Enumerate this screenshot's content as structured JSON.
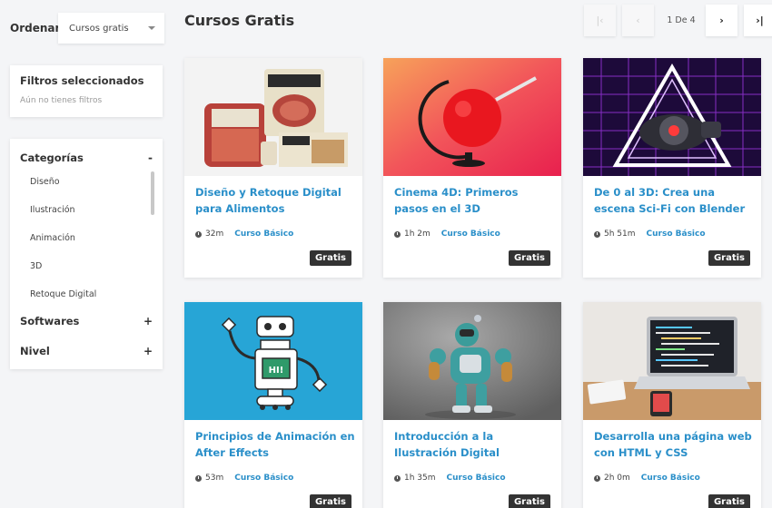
{
  "sort": {
    "label": "Ordenar",
    "selected": "Cursos gratis"
  },
  "filters": {
    "title": "Filtros seleccionados",
    "empty": "Aún no tienes filtros"
  },
  "categories": {
    "title": "Categorías",
    "toggle": "-",
    "items": [
      "Diseño",
      "Ilustración",
      "Animación",
      "3D",
      "Retoque Digital"
    ]
  },
  "softwares": {
    "title": "Softwares",
    "toggle": "+"
  },
  "nivel": {
    "title": "Nivel",
    "toggle": "+"
  },
  "page_title": "Cursos Gratis",
  "pagination": {
    "first": "|‹",
    "prev": "‹",
    "info": "1 De 4",
    "next": "›",
    "last": "›|"
  },
  "courses": [
    {
      "title": "Diseño y Retoque Digital para Alimentos",
      "duration": "32m",
      "level": "Curso Básico",
      "badge": "Gratis",
      "bg": "#f2f2f2"
    },
    {
      "title": "Cinema 4D: Primeros pasos en el 3D",
      "duration": "1h 2m",
      "level": "Curso Básico",
      "badge": "Gratis",
      "bg": "#ef4f4f"
    },
    {
      "title": "De 0 al 3D: Crea una escena Sci-Fi con Blender",
      "duration": "5h 51m",
      "level": "Curso Básico",
      "badge": "Gratis",
      "bg": "#2a0f4a"
    },
    {
      "title": "Principios de Animación en After Effects",
      "duration": "53m",
      "level": "Curso Básico",
      "badge": "Gratis",
      "bg": "#26a4d4"
    },
    {
      "title": "Introducción a la Ilustración Digital",
      "duration": "1h 35m",
      "level": "Curso Básico",
      "badge": "Gratis",
      "bg": "#8a8a8a"
    },
    {
      "title": "Desarrolla una página web con HTML y CSS",
      "duration": "2h 0m",
      "level": "Curso Básico",
      "badge": "Gratis",
      "bg": "#e9e6e2"
    }
  ],
  "robot_screen": "HI!"
}
